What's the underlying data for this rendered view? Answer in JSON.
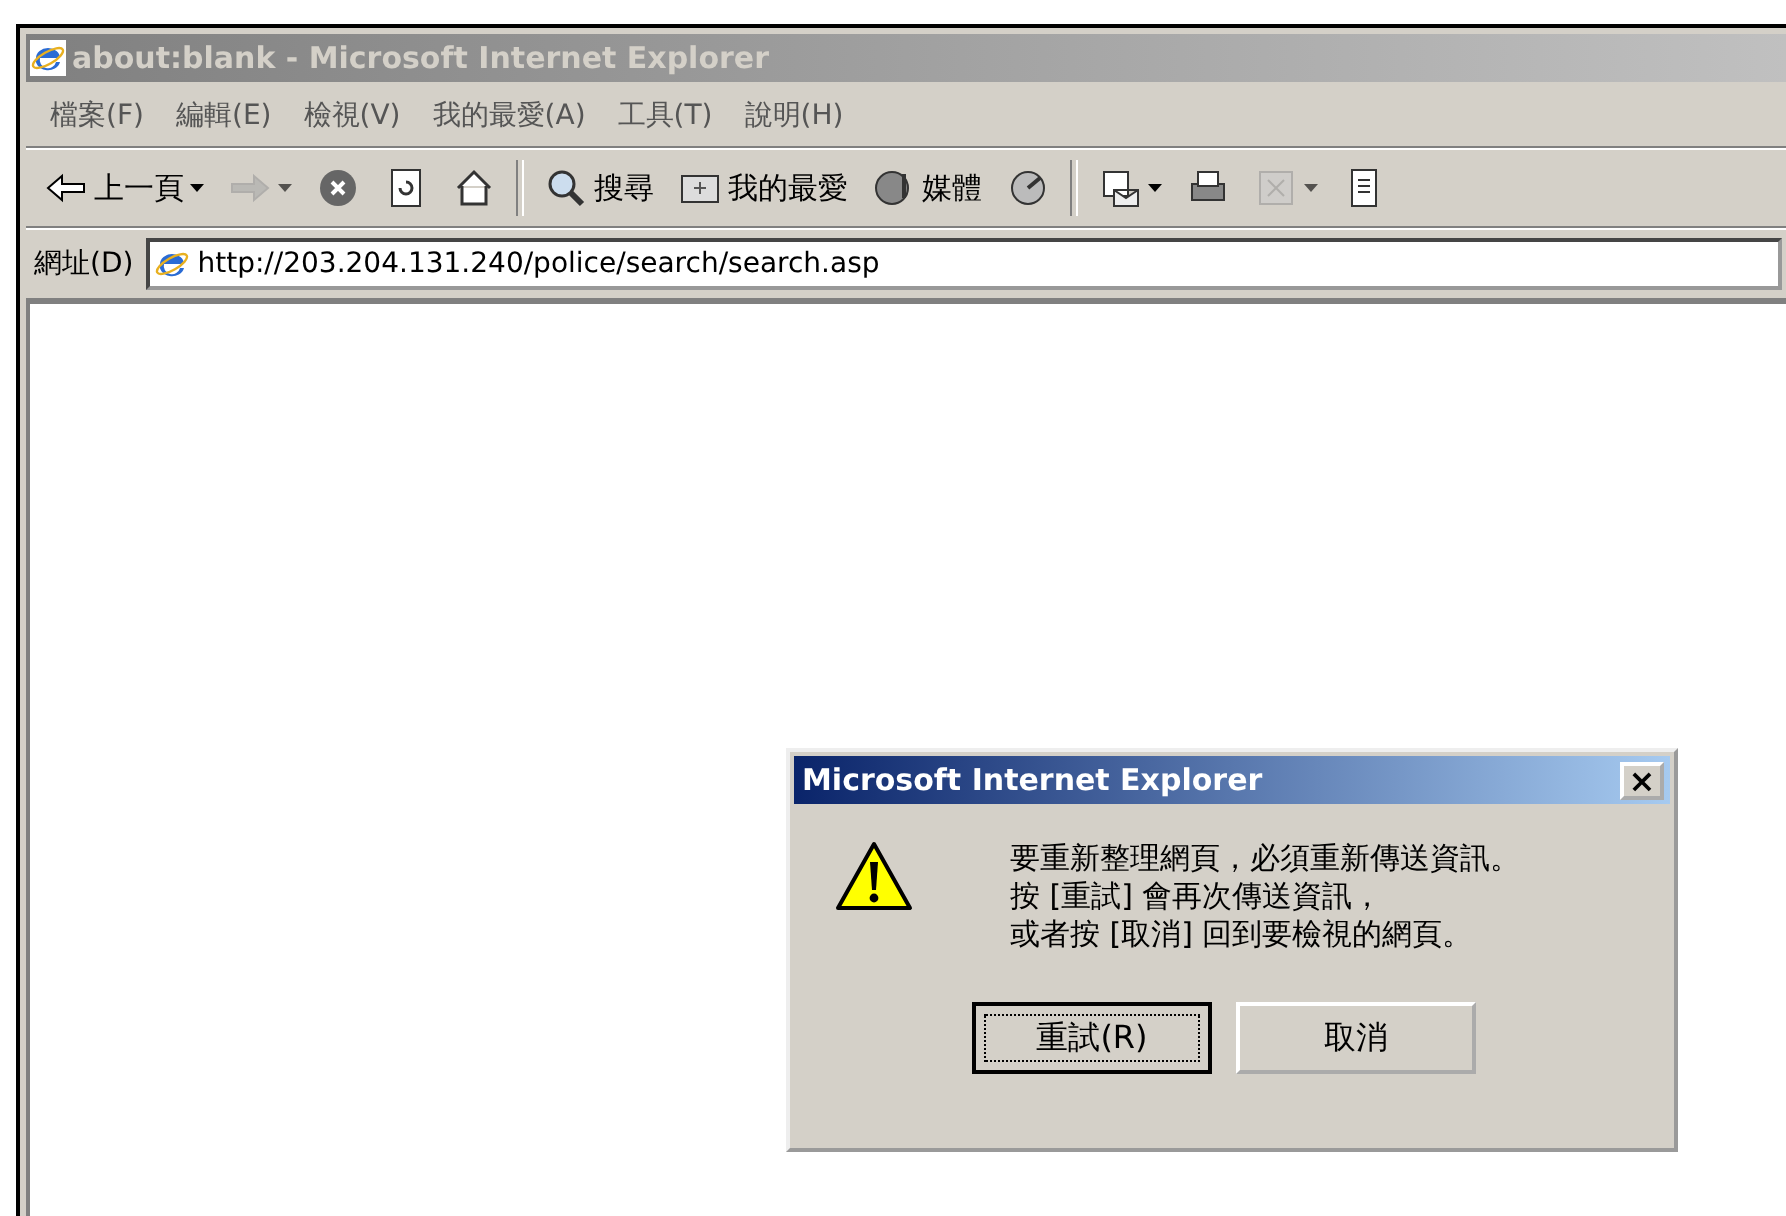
{
  "window": {
    "title": "about:blank - Microsoft Internet Explorer",
    "active": false
  },
  "menu": [
    {
      "label": "檔案(F)"
    },
    {
      "label": "編輯(E)"
    },
    {
      "label": "檢視(V)"
    },
    {
      "label": "我的最愛(A)"
    },
    {
      "label": "工具(T)"
    },
    {
      "label": "說明(H)"
    }
  ],
  "toolbar": [
    {
      "kind": "back",
      "label": "上一頁",
      "dropdown": true,
      "disabled": false
    },
    {
      "kind": "forward",
      "dropdown": true,
      "disabled": true
    },
    {
      "kind": "stop",
      "dropdown": false,
      "disabled": false
    },
    {
      "kind": "refresh",
      "dropdown": false,
      "disabled": false
    },
    {
      "kind": "home",
      "dropdown": false,
      "disabled": false
    },
    {
      "kind": "separator"
    },
    {
      "kind": "search",
      "label": "搜尋",
      "dropdown": false,
      "disabled": false
    },
    {
      "kind": "favorites",
      "label": "我的最愛",
      "dropdown": false,
      "disabled": false
    },
    {
      "kind": "media",
      "label": "媒體",
      "dropdown": false,
      "disabled": false
    },
    {
      "kind": "history",
      "dropdown": false,
      "disabled": false
    },
    {
      "kind": "separator"
    },
    {
      "kind": "mail",
      "dropdown": true,
      "disabled": false
    },
    {
      "kind": "print",
      "dropdown": false,
      "disabled": false
    },
    {
      "kind": "edit",
      "dropdown": true,
      "disabled": true
    },
    {
      "kind": "discuss",
      "dropdown": false,
      "disabled": false
    }
  ],
  "address_bar": {
    "label": "網址(D)",
    "value": "http://203.204.131.240/police/search/search.asp"
  },
  "dialog": {
    "title": "Microsoft Internet Explorer",
    "close": "×",
    "message_lines": [
      "要重新整理網頁，必須重新傳送資訊。",
      "按 [重試] 會再次傳送資訊，",
      "或者按 [取消] 回到要檢視的網頁。"
    ],
    "buttons": [
      {
        "label": "重試(R)",
        "focused": true
      },
      {
        "label": "取消",
        "focused": false
      }
    ]
  }
}
